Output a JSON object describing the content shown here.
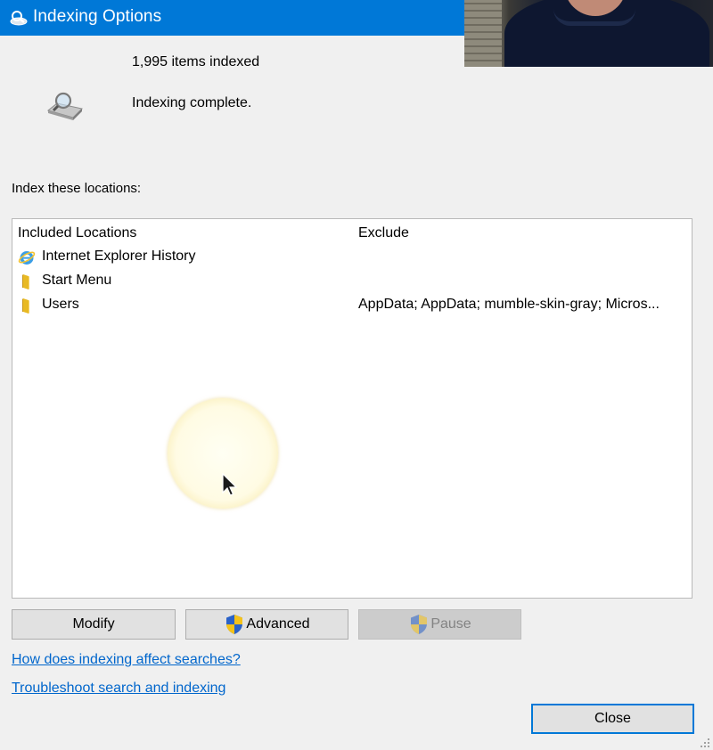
{
  "window": {
    "title": "Indexing Options",
    "title_icon": "indexing-options-icon"
  },
  "status": {
    "items_indexed": "1,995 items indexed",
    "state": "Indexing complete.",
    "icon": "magnifier-drive-icon"
  },
  "locations": {
    "section_label": "Index these locations:",
    "columns": {
      "included": "Included Locations",
      "exclude": "Exclude"
    },
    "rows": [
      {
        "name": "Internet Explorer History",
        "exclude": "",
        "icon": "internet-explorer-icon"
      },
      {
        "name": "Start Menu",
        "exclude": "",
        "icon": "folder-icon"
      },
      {
        "name": "Users",
        "exclude": "AppData; AppData; mumble-skin-gray; Micros...",
        "icon": "folder-icon"
      }
    ]
  },
  "buttons": {
    "modify": "Modify",
    "advanced": "Advanced",
    "pause": "Pause",
    "close": "Close"
  },
  "links": {
    "help": "How does indexing affect searches?",
    "troubleshoot": "Troubleshoot search and indexing"
  },
  "colors": {
    "titlebar": "#0078d7",
    "link": "#0066cc",
    "disabled_text": "#838383"
  }
}
